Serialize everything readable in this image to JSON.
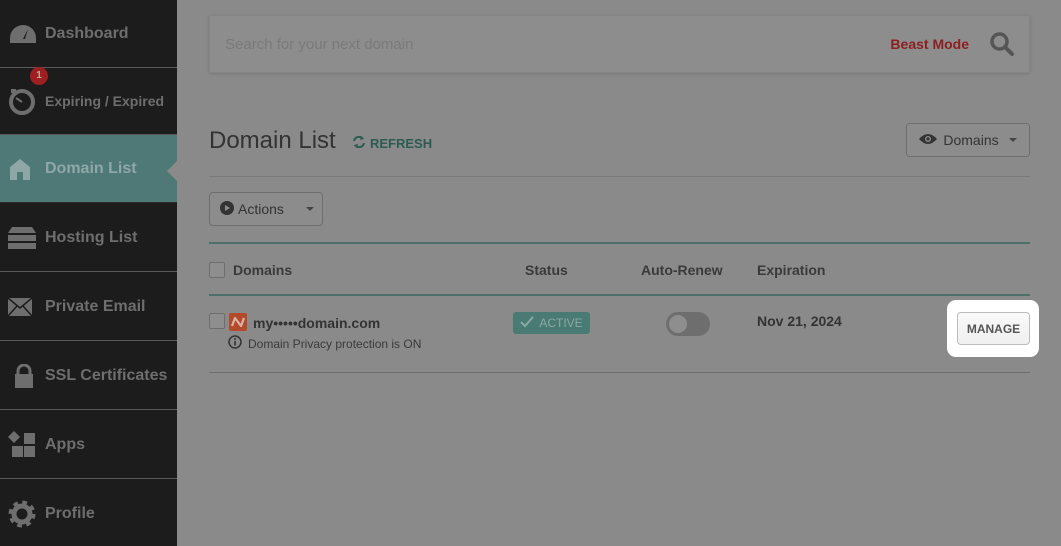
{
  "sidebar": {
    "items": [
      {
        "label": "Dashboard",
        "icon": "dashboard-gauge-icon"
      },
      {
        "label": "Expiring / Expired",
        "icon": "stopwatch-icon",
        "badge": "1"
      },
      {
        "label": "Domain List",
        "icon": "home-icon",
        "active": true
      },
      {
        "label": "Hosting List",
        "icon": "server-icon"
      },
      {
        "label": "Private Email",
        "icon": "envelope-icon"
      },
      {
        "label": "SSL Certificates",
        "icon": "lock-icon"
      },
      {
        "label": "Apps",
        "icon": "apps-icon"
      },
      {
        "label": "Profile",
        "icon": "gear-icon"
      }
    ]
  },
  "search": {
    "placeholder": "Search for your next domain",
    "value": "",
    "beast_mode_label": "Beast Mode"
  },
  "main": {
    "title": "Domain List",
    "refresh_label": "REFRESH",
    "view_dropdown_label": "Domains",
    "actions_label": "Actions",
    "columns": [
      "Domains",
      "Status",
      "Auto-Renew",
      "Expiration"
    ],
    "rows": [
      {
        "domain": "my•••••domain.com",
        "privacy_note": "Domain Privacy protection is ON",
        "status": "ACTIVE",
        "auto_renew": false,
        "expiration": "Nov 21, 2024",
        "action_label": "MANAGE"
      }
    ]
  },
  "colors": {
    "accent": "#4f7977",
    "beast_mode": "#8c2020",
    "badge": "#9e1f1f"
  }
}
